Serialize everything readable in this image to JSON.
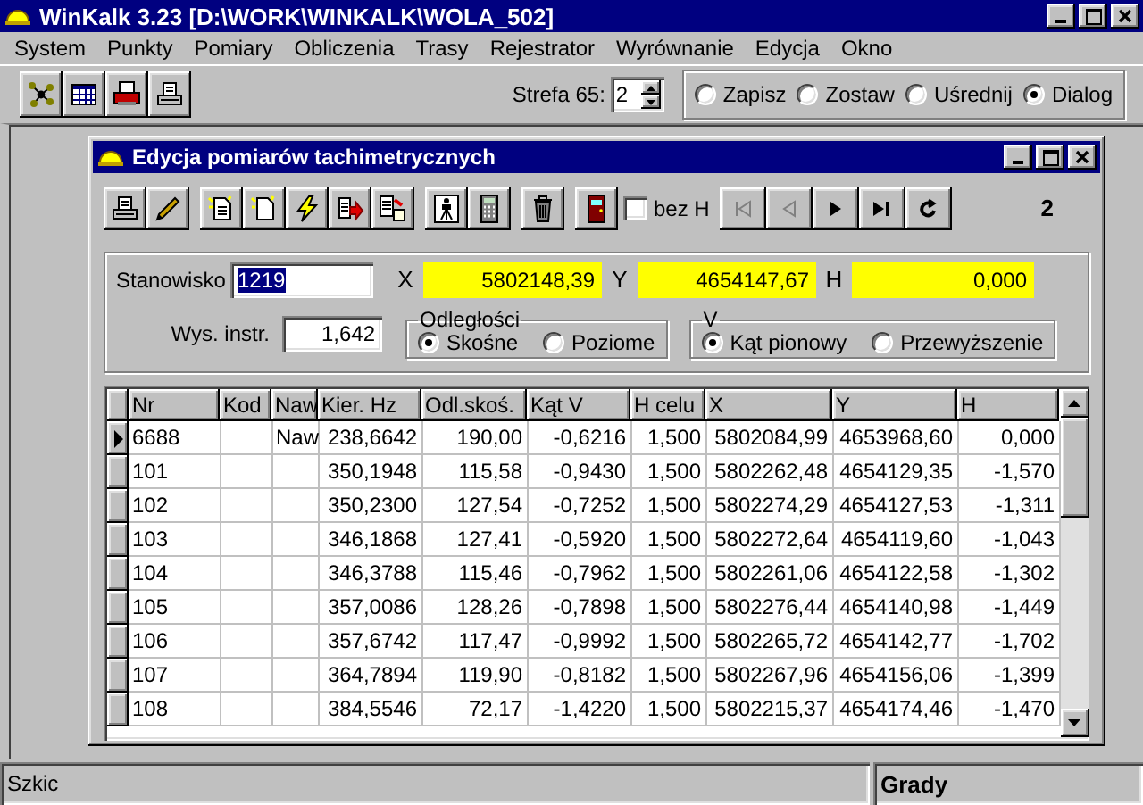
{
  "window": {
    "title": "WinKalk 3.23 [D:\\WORK\\WINKALK\\WOLA_502]"
  },
  "menu": [
    {
      "label": "System"
    },
    {
      "label": "Punkty"
    },
    {
      "label": "Pomiary"
    },
    {
      "label": "Obliczenia"
    },
    {
      "label": "Trasy"
    },
    {
      "label": "Rejestrator"
    },
    {
      "label": "Wyrównanie"
    },
    {
      "label": "Edycja"
    },
    {
      "label": "Okno"
    }
  ],
  "strefa": {
    "label": "Strefa 65:",
    "value": "2"
  },
  "save_mode": [
    {
      "label": "Zapisz",
      "selected": false
    },
    {
      "label": "Zostaw",
      "selected": false
    },
    {
      "label": "Uśrednij",
      "selected": false
    },
    {
      "label": "Dialog",
      "selected": true
    }
  ],
  "child": {
    "title": "Edycja pomiarów tachimetrycznych",
    "bez_h": {
      "label": "bez H",
      "checked": false
    },
    "nav_buttons": [
      {
        "disabled": true
      },
      {
        "disabled": true
      },
      {
        "disabled": false
      },
      {
        "disabled": false
      },
      {
        "disabled": false
      }
    ],
    "counter": "2",
    "station": {
      "label": "Stanowisko",
      "value": "1219",
      "highlighted": true
    },
    "coords": [
      {
        "label": "X",
        "value": "5802148,39"
      },
      {
        "label": "Y",
        "value": "4654147,67"
      },
      {
        "label": "H",
        "value": "0,000"
      }
    ],
    "instr": {
      "label": "Wys. instr.",
      "value": "1,642"
    },
    "groups": [
      {
        "title": "Odległości",
        "options": [
          {
            "label": "Skośne",
            "selected": true
          },
          {
            "label": "Poziome",
            "selected": false
          }
        ]
      },
      {
        "title": "V",
        "options": [
          {
            "label": "Kąt pionowy",
            "selected": true
          },
          {
            "label": "Przewyższenie",
            "selected": false
          }
        ]
      }
    ],
    "table": {
      "columns": [
        "Nr",
        "Kod",
        "Naw",
        "Kier. Hz",
        "Odl.skoś.",
        "Kąt V",
        "H celu",
        "X",
        "Y",
        "H"
      ],
      "rows": [
        {
          "current": true,
          "cells": [
            "6688",
            "",
            "Naw",
            "238,6642",
            "190,00",
            "-0,6216",
            "1,500",
            "5802084,99",
            "4653968,60",
            "0,000"
          ]
        },
        {
          "current": false,
          "cells": [
            "101",
            "",
            "",
            "350,1948",
            "115,58",
            "-0,9430",
            "1,500",
            "5802262,48",
            "4654129,35",
            "-1,570"
          ]
        },
        {
          "current": false,
          "cells": [
            "102",
            "",
            "",
            "350,2300",
            "127,54",
            "-0,7252",
            "1,500",
            "5802274,29",
            "4654127,53",
            "-1,311"
          ]
        },
        {
          "current": false,
          "cells": [
            "103",
            "",
            "",
            "346,1868",
            "127,41",
            "-0,5920",
            "1,500",
            "5802272,64",
            "4654119,60",
            "-1,043"
          ]
        },
        {
          "current": false,
          "cells": [
            "104",
            "",
            "",
            "346,3788",
            "115,46",
            "-0,7962",
            "1,500",
            "5802261,06",
            "4654122,58",
            "-1,302"
          ]
        },
        {
          "current": false,
          "cells": [
            "105",
            "",
            "",
            "357,0086",
            "128,26",
            "-0,7898",
            "1,500",
            "5802276,44",
            "4654140,98",
            "-1,449"
          ]
        },
        {
          "current": false,
          "cells": [
            "106",
            "",
            "",
            "357,6742",
            "117,47",
            "-0,9992",
            "1,500",
            "5802265,72",
            "4654142,77",
            "-1,702"
          ]
        },
        {
          "current": false,
          "cells": [
            "107",
            "",
            "",
            "364,7894",
            "119,90",
            "-0,8182",
            "1,500",
            "5802267,96",
            "4654156,06",
            "-1,399"
          ]
        },
        {
          "current": false,
          "cells": [
            "108",
            "",
            "",
            "384,5546",
            "72,17",
            "-1,4220",
            "1,500",
            "5802215,37",
            "4654174,46",
            "-1,470"
          ]
        }
      ]
    }
  },
  "status_bar": [
    {
      "text": "Szkic",
      "bold": false
    },
    {
      "text": "Grady",
      "bold": true
    }
  ]
}
